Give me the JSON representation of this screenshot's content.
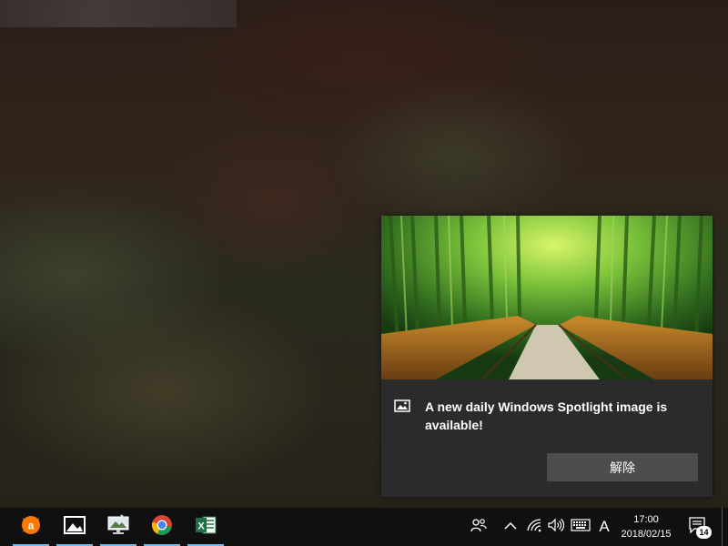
{
  "toast": {
    "message": "A new daily Windows Spotlight image is available!",
    "dismiss_label": "解除",
    "app_icon": "spotlight-photo-icon"
  },
  "taskbar": {
    "apps": [
      {
        "name": "avast",
        "icon": "avast-icon",
        "active": true
      },
      {
        "name": "photos",
        "icon": "photos-icon",
        "active": true
      },
      {
        "name": "spotlight-tool",
        "icon": "picture-monitor-icon",
        "active": true
      },
      {
        "name": "chrome",
        "icon": "chrome-icon",
        "active": true
      },
      {
        "name": "excel",
        "icon": "excel-icon",
        "active": true
      }
    ],
    "tray": {
      "people_icon": "people-icon",
      "chevron_icon": "chevron-up-icon",
      "network_icon": "wifi-icon",
      "volume_icon": "volume-icon",
      "keyboard_icon": "keyboard-icon",
      "ime_label": "A",
      "time": "17:00",
      "date": "2018/02/15",
      "notification_count": "14"
    }
  },
  "colors": {
    "taskbar_bg": "#101010",
    "toast_bg": "#2b2b2b",
    "button_bg": "#4d4d4d",
    "active_underline": "#76b9ed"
  }
}
